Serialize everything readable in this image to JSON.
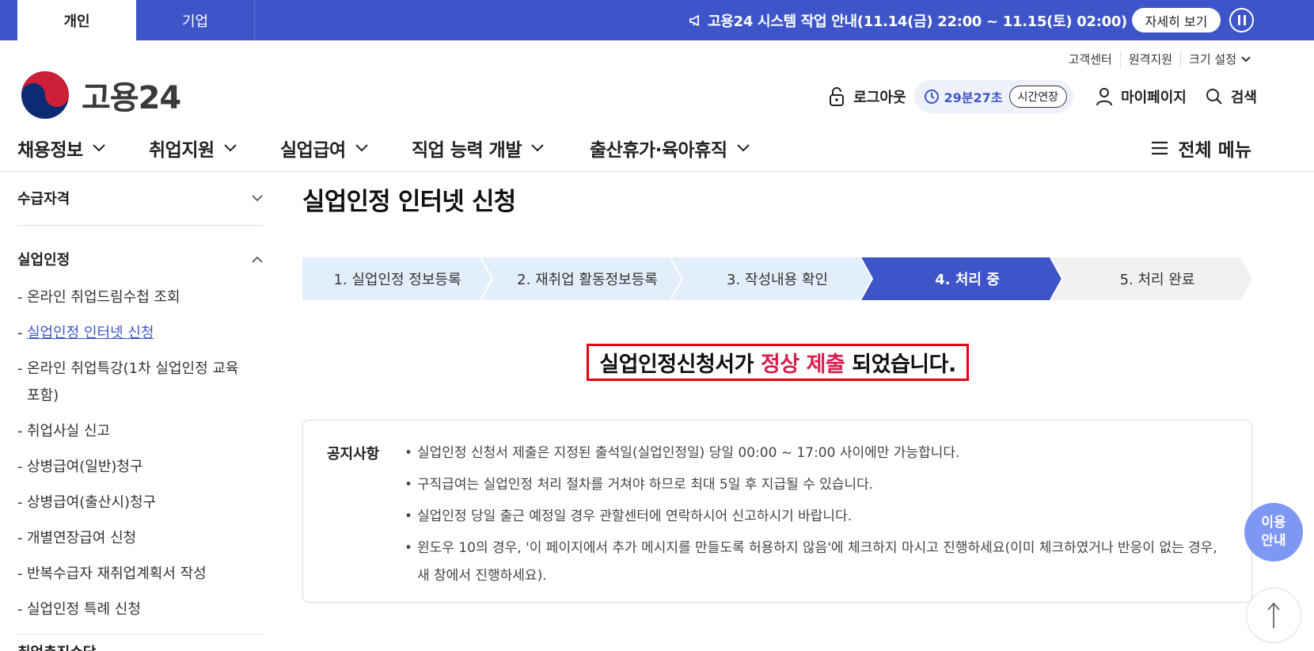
{
  "topbar": {
    "tabs": [
      {
        "label": "개인"
      },
      {
        "label": "기업"
      }
    ],
    "notice_text": "고용24 시스템 작업 안내(11.14(금) 22:00 ~ 11.15(토) 02:00)",
    "detail_label": "자세히 보기"
  },
  "util": {
    "links": [
      "고객센터",
      "원격지원",
      "크기 설정"
    ]
  },
  "logo": {
    "text": "고용24"
  },
  "header": {
    "logout_label": "로그아웃",
    "timer": "29분27초",
    "extend_label": "시간연장",
    "mypage_label": "마이페이지",
    "search_label": "검색"
  },
  "gnb": {
    "items": [
      "채용정보",
      "취업지원",
      "실업급여",
      "직업 능력 개발",
      "출산휴가·육아휴직"
    ],
    "all_menu_label": "전체 메뉴"
  },
  "sidebar": {
    "sections": [
      "수급자격",
      "실업인정"
    ],
    "items": [
      "온라인 취업드림수첩 조회",
      "실업인정 인터넷 신청",
      "온라인 취업특강(1차 실업인정 교육 포함)",
      "취업사실 신고",
      "상병급여(일반)청구",
      "상병급여(출산시)청구",
      "개별연장급여 신청",
      "반복수급자 재취업계획서 작성",
      "실업인정 특례 신청"
    ],
    "active_index": 1,
    "next_section_partial": "취업촉진수당"
  },
  "main": {
    "title": "실업인정 인터넷 신청",
    "steps": [
      {
        "label": "1. 실업인정 정보등록",
        "state": "done"
      },
      {
        "label": "2. 재취업 활동정보등록",
        "state": "done"
      },
      {
        "label": "3. 작성내용 확인",
        "state": "done"
      },
      {
        "label": "4. 처리 중",
        "state": "active"
      },
      {
        "label": "5. 처리 완료",
        "state": "todo"
      }
    ],
    "result": {
      "prefix": "실업인정신청서가",
      "highlight": "정상 제출",
      "suffix": "되었습니다."
    },
    "notice": {
      "title": "공지사항",
      "items": [
        "실업인정 신청서 제출은 지정된 출석일(실업인정일) 당일 00:00 ~ 17:00 사이에만 가능합니다.",
        "구직급여는 실업인정 처리 절차를 거쳐야 하므로 최대 5일 후 지급될 수 있습니다.",
        "실업인정 당일 출근 예정일 경우 관할센터에 연락하시어 신고하시기 바랍니다.",
        "윈도우 10의 경우, '이 페이지에서 추가 메시지를 만들도록 허용하지 않음'에 체크하지 마시고 진행하세요(이미 체크하였거나 반응이 없는 경우, 새 창에서 진행하세요)."
      ]
    }
  },
  "floating": {
    "guide_label": "이용 안내"
  },
  "colors": {
    "brand": "#3d55c9",
    "step_done": "#e3eefb",
    "step_active": "#3d55c9",
    "step_todo": "#f1f1f1",
    "highlight": "#d6204f",
    "result_border": "#e60012"
  },
  "icons": {
    "notice": "megaphone-icon",
    "pause": "pause-icon",
    "logout": "lock-icon",
    "timer": "clock-icon",
    "mypage": "user-icon",
    "search": "search-icon",
    "all_menu": "hamburger-icon",
    "top": "arrow-up-icon"
  }
}
